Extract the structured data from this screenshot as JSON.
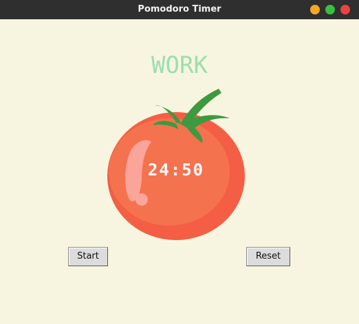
{
  "window": {
    "title": "Pomodoro Timer"
  },
  "timer": {
    "mode_label": "WORK",
    "time_display": "24:50"
  },
  "controls": {
    "start_label": "Start",
    "reset_label": "Reset"
  },
  "colors": {
    "background": "#f7f5df",
    "mode_text": "#9bdfad",
    "tomato": "#f26649",
    "leaf": "#3d9a3f"
  }
}
